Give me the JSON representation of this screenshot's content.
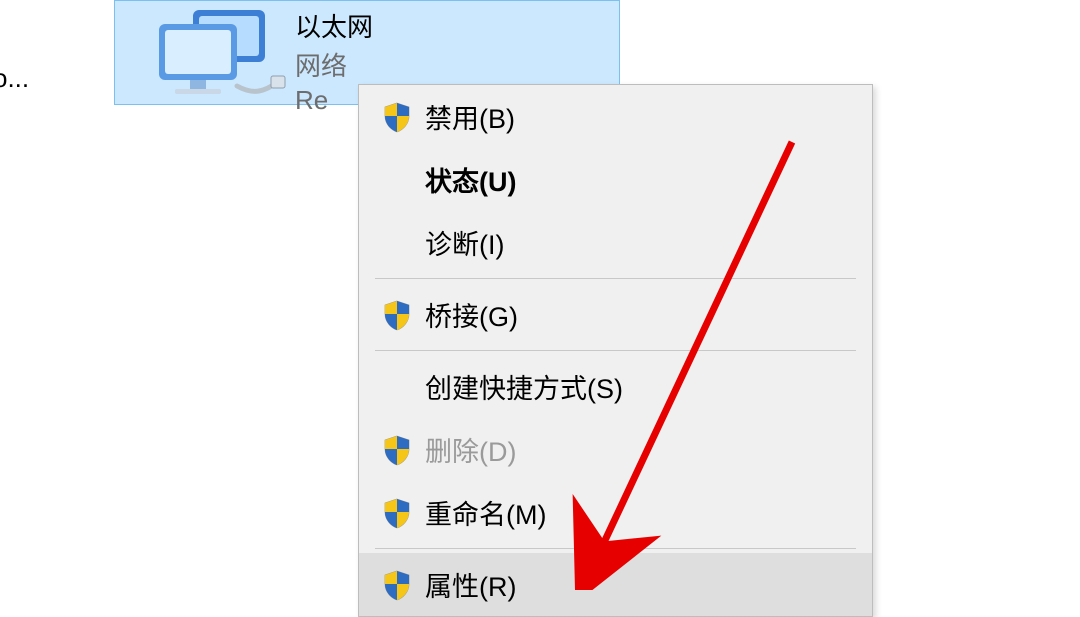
{
  "truncated_left_text": "so...",
  "adapter": {
    "title": "以太网",
    "subtitle": "网络",
    "detail_truncated": "Re"
  },
  "context_menu": {
    "items": [
      {
        "label": "禁用(B)",
        "shield": true,
        "bold": false,
        "disabled": false,
        "hover": false
      },
      {
        "label": "状态(U)",
        "shield": false,
        "bold": true,
        "disabled": false,
        "hover": false
      },
      {
        "label": "诊断(I)",
        "shield": false,
        "bold": false,
        "disabled": false,
        "hover": false
      },
      {
        "separator": true
      },
      {
        "label": "桥接(G)",
        "shield": true,
        "bold": false,
        "disabled": false,
        "hover": false
      },
      {
        "separator": true
      },
      {
        "label": "创建快捷方式(S)",
        "shield": false,
        "bold": false,
        "disabled": false,
        "hover": false
      },
      {
        "label": "删除(D)",
        "shield": true,
        "bold": false,
        "disabled": true,
        "hover": false
      },
      {
        "label": "重命名(M)",
        "shield": true,
        "bold": false,
        "disabled": false,
        "hover": false
      },
      {
        "separator": true
      },
      {
        "label": "属性(R)",
        "shield": true,
        "bold": false,
        "disabled": false,
        "hover": true
      }
    ]
  },
  "annotation": {
    "arrow_color": "#e60000"
  }
}
